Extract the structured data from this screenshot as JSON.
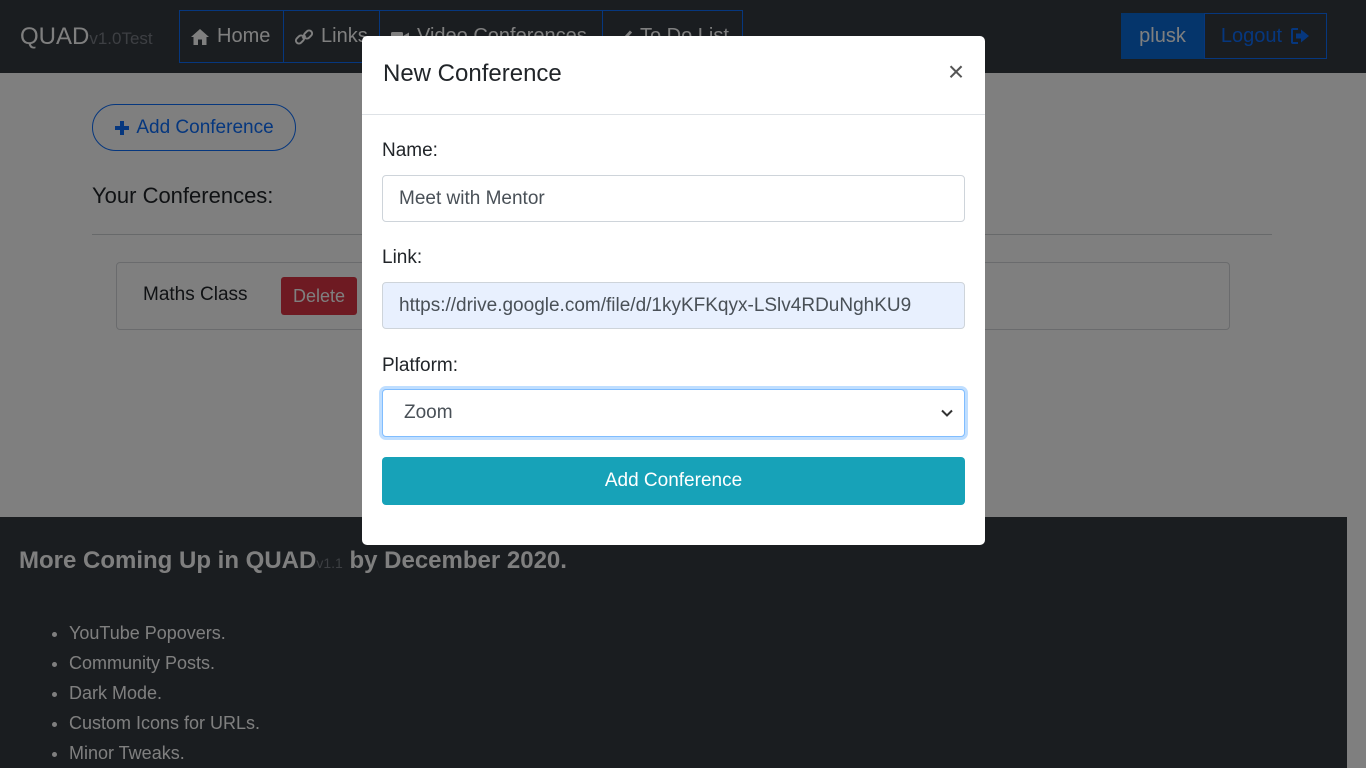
{
  "navbar": {
    "brand": "QUAD",
    "brand_version": "v1.0Test",
    "nav_items": [
      {
        "label": "Home",
        "icon": "home-icon"
      },
      {
        "label": "Links",
        "icon": "link-icon"
      },
      {
        "label": "Video Conferences",
        "icon": "video-camera-icon"
      },
      {
        "label": "To Do List",
        "icon": "check-icon"
      }
    ],
    "username": "plusk",
    "logout_label": "Logout"
  },
  "main": {
    "add_button_label": "Add Conference",
    "section_title": "Your Conferences:",
    "conferences": [
      {
        "name": "Maths Class",
        "delete_label": "Delete"
      }
    ]
  },
  "footer": {
    "title_prefix": "More Coming Up in QUAD",
    "title_version": "v1.1",
    "title_suffix": "by December 2020.",
    "items": [
      "YouTube Popovers.",
      "Community Posts.",
      "Dark Mode.",
      "Custom Icons for URLs.",
      "Minor Tweaks."
    ]
  },
  "modal": {
    "title": "New Conference",
    "close_glyph": "×",
    "name_label": "Name:",
    "name_value": "Meet with Mentor",
    "link_label": "Link:",
    "link_value": "https://drive.google.com/file/d/1kyKFKqyx-LSlv4RDuNghKU9",
    "platform_label": "Platform:",
    "platform_value": "Zoom",
    "submit_label": "Add Conference"
  },
  "colors": {
    "navbar_bg": "#343a40",
    "primary": "#0d6efd",
    "danger": "#dc3545",
    "info": "#17a2b8"
  }
}
